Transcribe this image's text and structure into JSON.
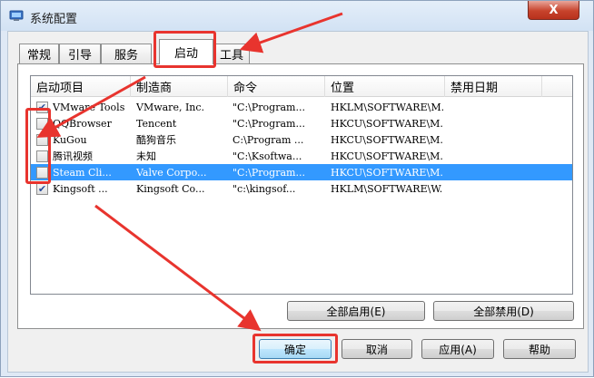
{
  "window": {
    "title": "系统配置",
    "close_label": "X"
  },
  "tabs": [
    {
      "label": "常规"
    },
    {
      "label": "引导"
    },
    {
      "label": "服务"
    },
    {
      "label": "启动"
    },
    {
      "label": "工具"
    }
  ],
  "active_tab": "启动",
  "list": {
    "columns": [
      "启动项目",
      "制造商",
      "命令",
      "位置",
      "禁用日期"
    ],
    "rows": [
      {
        "checked": true,
        "item": "VMware Tools",
        "maker": "VMware, Inc.",
        "command": "\"C:\\Program...",
        "location": "HKLM\\SOFTWARE\\M...",
        "disabled_date": ""
      },
      {
        "checked": false,
        "item": "QQBrowser",
        "maker": "Tencent",
        "command": "\"C:\\Program...",
        "location": "HKCU\\SOFTWARE\\M...",
        "disabled_date": ""
      },
      {
        "checked": false,
        "item": "KuGou",
        "maker": "酷狗音乐",
        "command": "C:\\Program ...",
        "location": "HKCU\\SOFTWARE\\M...",
        "disabled_date": ""
      },
      {
        "checked": false,
        "item": "腾讯视频",
        "maker": "未知",
        "command": "\"C:\\Ksoftwa...",
        "location": "HKCU\\SOFTWARE\\M...",
        "disabled_date": ""
      },
      {
        "checked": false,
        "item": "Steam Cli...",
        "maker": "Valve Corpo...",
        "command": "\"C:\\Program...",
        "location": "HKCU\\SOFTWARE\\M...",
        "disabled_date": "",
        "selected": true
      },
      {
        "checked": true,
        "item": "Kingsoft ...",
        "maker": "Kingsoft Co...",
        "command": "\"c:\\kingsof...",
        "location": "HKLM\\SOFTWARE\\W...",
        "disabled_date": ""
      }
    ]
  },
  "list_buttons": {
    "enable_all": "全部启用(E)",
    "disable_all": "全部禁用(D)"
  },
  "dialog_buttons": {
    "ok": "确定",
    "cancel": "取消",
    "apply": "应用(A)",
    "help": "帮助"
  },
  "colors": {
    "annotation_red": "#e8342e",
    "selection_blue": "#3399ff"
  }
}
